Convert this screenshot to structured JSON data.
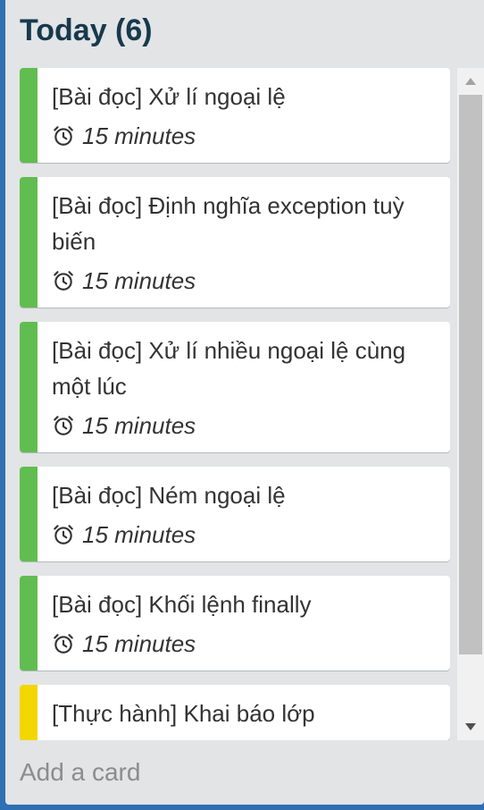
{
  "list": {
    "title": "Today (6)",
    "add_card_label": "Add a card",
    "colors": {
      "green_label": "#61bd4f",
      "yellow_label": "#f2d600"
    },
    "cards": [
      {
        "title": "[Bài đọc] Xử lí ngoại lệ",
        "duration": "15 minutes",
        "label_color": "green",
        "icon": "alarm-clock-icon"
      },
      {
        "title": "[Bài đọc] Định nghĩa exception tuỳ biến",
        "duration": "15 minutes",
        "label_color": "green",
        "icon": "alarm-clock-icon"
      },
      {
        "title": "[Bài đọc] Xử lí nhiều ngoại lệ cùng một lúc",
        "duration": "15 minutes",
        "label_color": "green",
        "icon": "alarm-clock-icon"
      },
      {
        "title": "[Bài đọc] Ném ngoại lệ",
        "duration": "15 minutes",
        "label_color": "green",
        "icon": "alarm-clock-icon"
      },
      {
        "title": "[Bài đọc] Khối lệnh finally",
        "duration": "15 minutes",
        "label_color": "green",
        "icon": "alarm-clock-icon"
      },
      {
        "title": "[Thực hành] Khai báo lớp",
        "duration": "",
        "label_color": "yellow",
        "icon": ""
      }
    ]
  }
}
